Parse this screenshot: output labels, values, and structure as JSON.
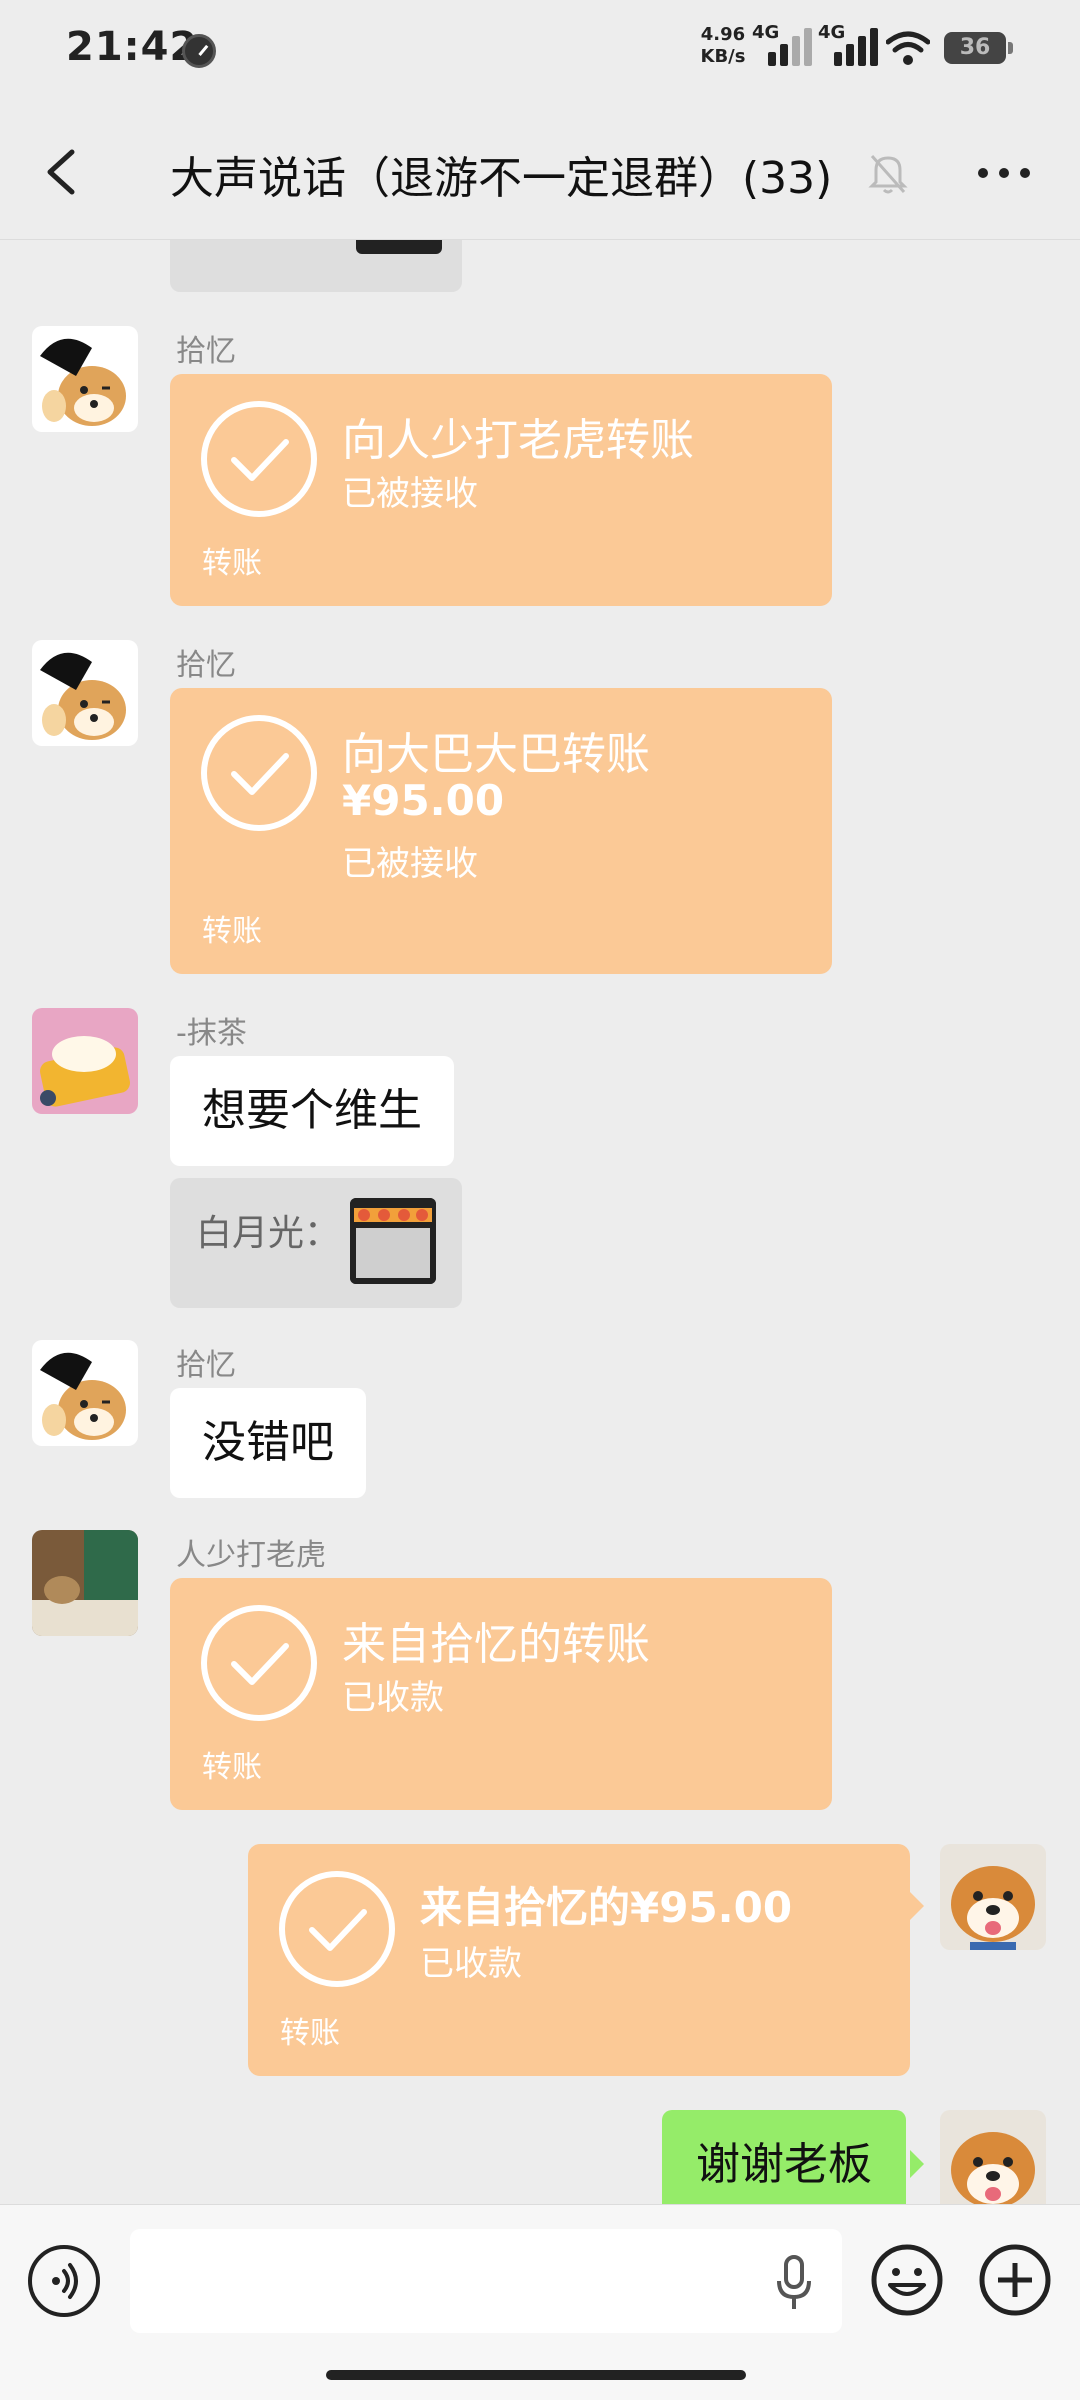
{
  "status_bar": {
    "time": "21:42",
    "net_speed": "4.96",
    "net_unit": "KB/s",
    "sim1": "4G",
    "sim2": "4G",
    "battery": "36"
  },
  "header": {
    "title": "大声说话（退游不一定退群）(33)",
    "icons": [
      "back-icon",
      "mute-bell-icon",
      "more-icon"
    ]
  },
  "messages": [
    {
      "type": "transfer",
      "sender": "拾忆",
      "title": "向人少打老虎转账",
      "status": "已被接收",
      "label": "转账"
    },
    {
      "type": "transfer",
      "sender": "拾忆",
      "title": "向大巴大巴转账",
      "amount": "¥95.00",
      "status": "已被接收",
      "label": "转账"
    },
    {
      "type": "text",
      "sender": "-抹茶",
      "text": "想要个维生"
    },
    {
      "type": "quote",
      "text": "白月光："
    },
    {
      "type": "text",
      "sender": "拾忆",
      "text": "没错吧"
    },
    {
      "type": "transfer",
      "sender": "人少打老虎",
      "title": "来自拾忆的转账",
      "status": "已收款",
      "label": "转账"
    },
    {
      "type": "transfer",
      "self": true,
      "title": "来自拾忆的¥95.00",
      "status": "已收款",
      "label": "转账"
    },
    {
      "type": "text",
      "self": true,
      "text": "谢谢老板"
    }
  ],
  "input_bar": {
    "placeholder": "",
    "icons": [
      "voice-icon",
      "mic-icon",
      "emoji-icon",
      "plus-icon"
    ]
  },
  "colors": {
    "background": "#ededed",
    "transfer_bubble": "#fbc996",
    "self_text_bubble": "#95ec69"
  }
}
